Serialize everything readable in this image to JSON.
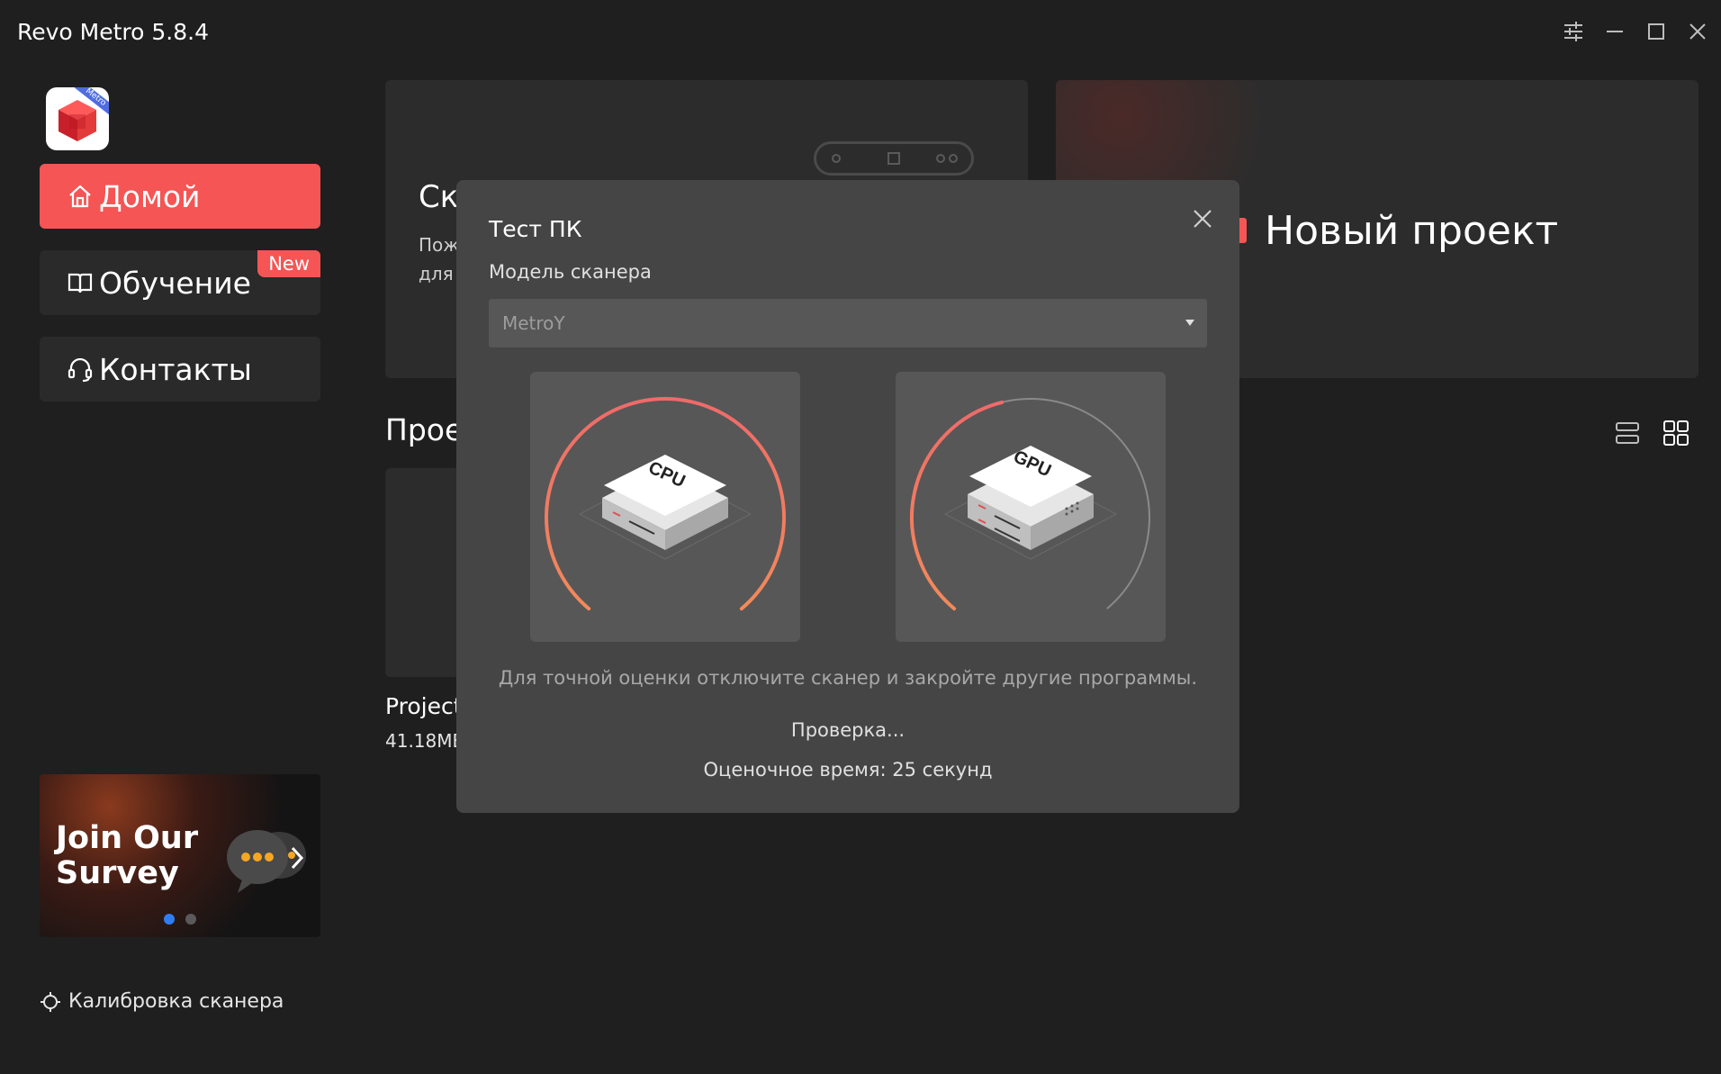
{
  "app": {
    "title": "Revo Metro 5.8.4"
  },
  "window_controls": [
    "settings-sliders",
    "minimize",
    "maximize",
    "close"
  ],
  "logo": {
    "tag": "Metro"
  },
  "sidebar": {
    "items": [
      {
        "label": "Домой",
        "icon": "home-icon",
        "active": true
      },
      {
        "label": "Обучение",
        "icon": "book-icon",
        "badge": "New"
      },
      {
        "label": "Контакты",
        "icon": "headset-icon"
      }
    ],
    "survey": {
      "text_line1": "Join Our",
      "text_line2": "Survey"
    },
    "calibration": {
      "label": "Калибровка сканера",
      "icon": "crosshair-icon"
    }
  },
  "cards": {
    "scan": {
      "title": "Ска",
      "desc_line1": "Пож",
      "desc_line2": "для"
    },
    "new_project": {
      "title": "Новый проект"
    }
  },
  "projects": {
    "section_title": "Прое",
    "item": {
      "name": "Project",
      "size": "41.18МБ"
    }
  },
  "dialog": {
    "title": "Тест ПК",
    "scanner_label": "Модель сканера",
    "scanner_value": "MetroY",
    "gauges": [
      {
        "name": "CPU",
        "progress": 1.0
      },
      {
        "name": "GPU",
        "progress": 0.45
      }
    ],
    "note": "Для точной оценки отключите сканер и закройте другие программы.",
    "status": "Проверка...",
    "eta": "Оценочное время: 25 секунд"
  },
  "colors": {
    "accent": "#f55555",
    "bg": "#1f1f1f",
    "dialog": "#454545"
  }
}
